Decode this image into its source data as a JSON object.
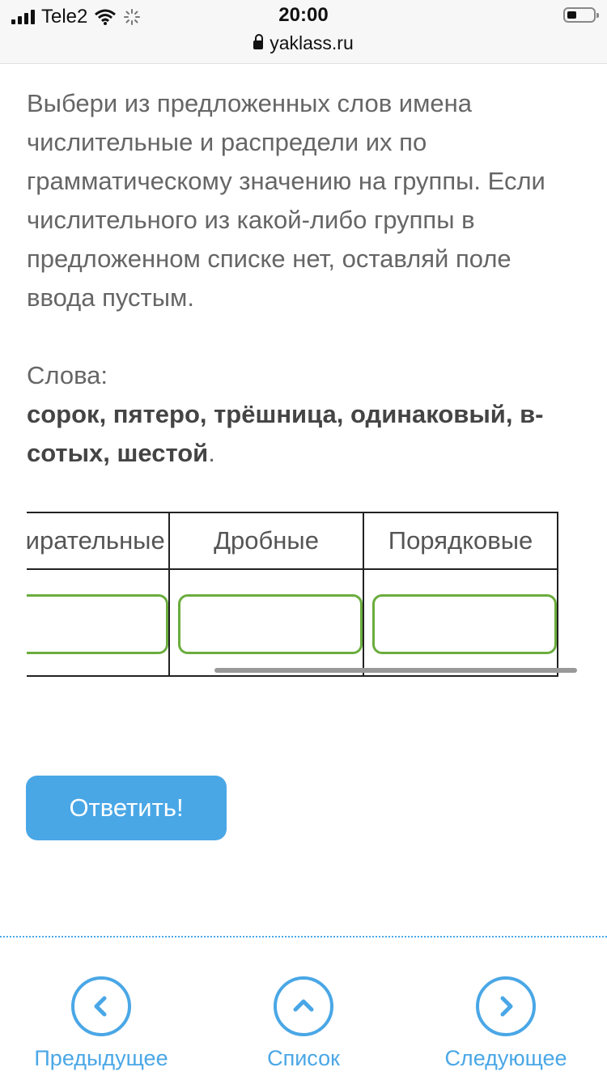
{
  "status": {
    "carrier": "Tele2",
    "time": "20:00",
    "url": "yaklass.ru"
  },
  "task": {
    "instruction": "Выбери из предложенных слов имена числительные и распредели их по грамматическому значению на группы. Если числительного из какой-либо группы в предложенном списке нет, оставляй поле ввода пустым.",
    "words_label": "Слова:",
    "words": "сорок, пятеро, трёшница, одинаковый, в-сотых, шестой",
    "words_end": "."
  },
  "table": {
    "headers": [
      "Собирательные",
      "Дробные",
      "Порядковые"
    ],
    "inputs": [
      "",
      "",
      ""
    ]
  },
  "submit_label": "Ответить!",
  "nav": {
    "prev_label": "Предыдущее",
    "list_label": "Список",
    "next_label": "Следующее"
  },
  "colors": {
    "accent": "#4aa7e6",
    "input_border": "#6aad3d"
  }
}
